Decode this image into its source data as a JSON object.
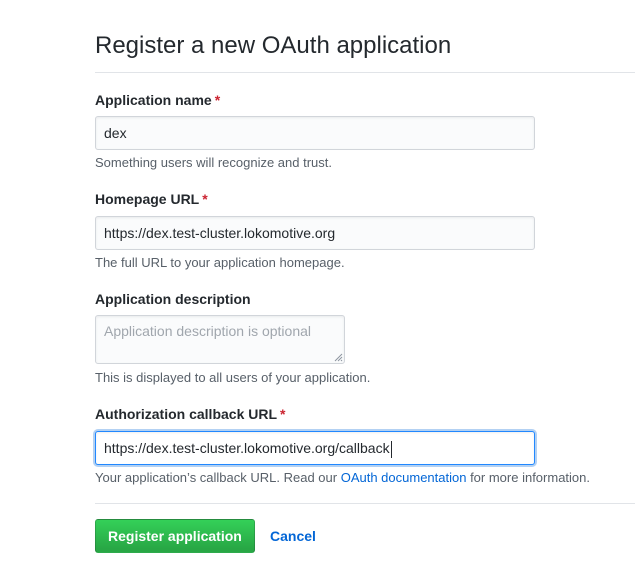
{
  "page": {
    "title": "Register a new OAuth application"
  },
  "form": {
    "app_name": {
      "label": "Application name",
      "required_mark": "*",
      "value": "dex",
      "note": "Something users will recognize and trust."
    },
    "homepage_url": {
      "label": "Homepage URL",
      "required_mark": "*",
      "value": "https://dex.test-cluster.lokomotive.org",
      "note": "The full URL to your application homepage."
    },
    "description": {
      "label": "Application description",
      "placeholder": "Application description is optional",
      "note": "This is displayed to all users of your application."
    },
    "callback_url": {
      "label": "Authorization callback URL",
      "required_mark": "*",
      "value": "https://dex.test-cluster.lokomotive.org/callback",
      "note_before": "Your application’s callback URL. Read our ",
      "note_link": "OAuth documentation",
      "note_after": " for more information."
    }
  },
  "actions": {
    "register_label": "Register application",
    "cancel_label": "Cancel"
  },
  "colors": {
    "required": "#cb2431",
    "link": "#0366d6",
    "primary_button": "#28a745",
    "focus_border": "#2188ff"
  }
}
